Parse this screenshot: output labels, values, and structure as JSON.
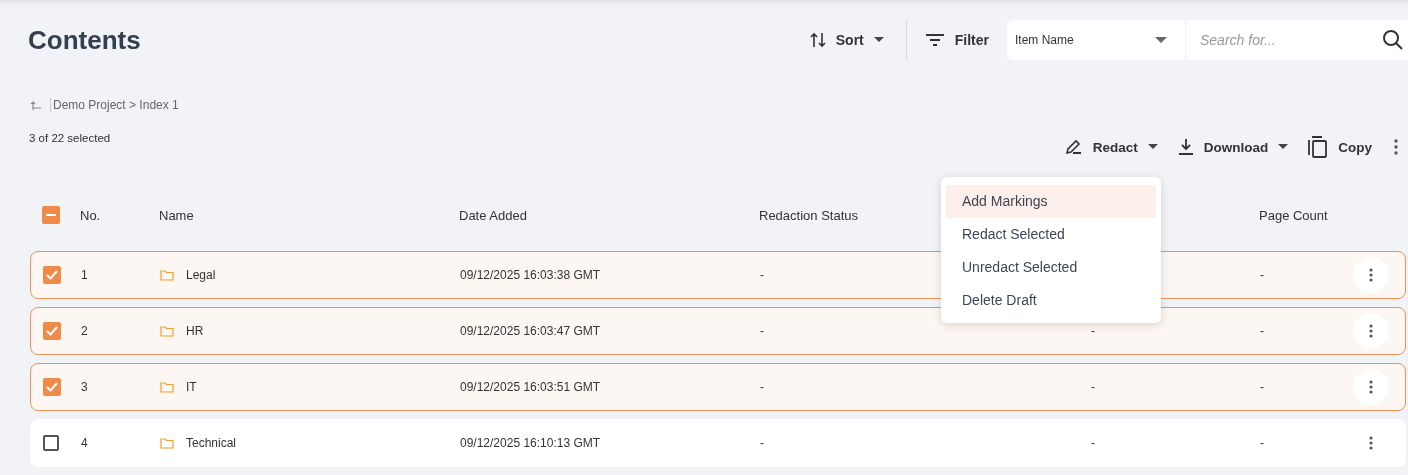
{
  "page_title": "Contents",
  "sort": {
    "label": "Sort"
  },
  "filter": {
    "label": "Filter"
  },
  "field_select": {
    "value": "Item Name"
  },
  "search": {
    "placeholder": "Search for..."
  },
  "breadcrumb": "Demo Project > Index 1",
  "selection_count": "3 of 22 selected",
  "actions": [
    {
      "label": "Redact",
      "kind": "pen",
      "dropdown": true
    },
    {
      "label": "Download",
      "kind": "download",
      "dropdown": true
    },
    {
      "label": "Copy",
      "kind": "copy",
      "dropdown": false
    }
  ],
  "table": {
    "select_all_indeterminate": true,
    "columns": [
      {
        "label": "No."
      },
      {
        "label": "Name"
      },
      {
        "label": "Date Added"
      },
      {
        "label": "Redaction Status"
      },
      {
        "label": "Page Count"
      }
    ],
    "rows": [
      {
        "checked": true,
        "no": "1",
        "name": "Legal",
        "date_added": "09/12/2025 16:03:38 GMT",
        "redaction_status": "-",
        "page_count": "-"
      },
      {
        "checked": true,
        "no": "2",
        "name": "HR",
        "date_added": "09/12/2025 16:03:47 GMT",
        "redaction_status": "-",
        "column_5": "-",
        "page_count": "-"
      },
      {
        "checked": true,
        "no": "3",
        "name": "IT",
        "date_added": "09/12/2025 16:03:51 GMT",
        "redaction_status": "-",
        "column_5": "-",
        "page_count": "-"
      },
      {
        "checked": false,
        "no": "4",
        "name": "Technical",
        "date_added": "09/12/2025 16:10:13 GMT",
        "redaction_status": "-",
        "column_5": "-",
        "page_count": "-"
      }
    ]
  },
  "redact_menu": [
    {
      "label": "Add Markings",
      "selected": true
    },
    {
      "label": "Redact Selected",
      "selected": false
    },
    {
      "label": "Unredact Selected",
      "selected": false
    },
    {
      "label": "Delete Draft",
      "selected": false
    }
  ]
}
